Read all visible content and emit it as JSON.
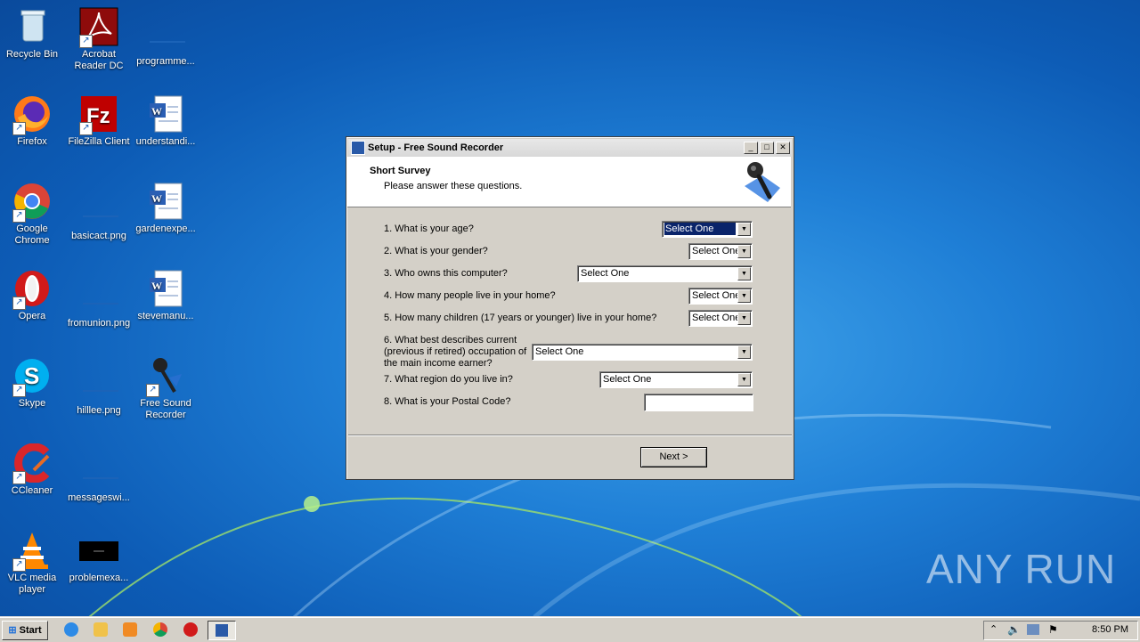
{
  "desktop": {
    "icons": [
      {
        "label": "Recycle Bin"
      },
      {
        "label": "Acrobat Reader DC"
      },
      {
        "label": "programme..."
      },
      {
        "label": "Firefox"
      },
      {
        "label": "FileZilla Client"
      },
      {
        "label": "understandi..."
      },
      {
        "label": "Google Chrome"
      },
      {
        "label": "basicact.png"
      },
      {
        "label": "gardenexpe..."
      },
      {
        "label": "Opera"
      },
      {
        "label": "fromunion.png"
      },
      {
        "label": "stevemanu..."
      },
      {
        "label": "Skype"
      },
      {
        "label": "hilllee.png"
      },
      {
        "label": "Free Sound Recorder"
      },
      {
        "label": "CCleaner"
      },
      {
        "label": "messageswi..."
      },
      {
        "label": "VLC media player"
      },
      {
        "label": "problemexa..."
      }
    ],
    "watermark": "ANY RUN"
  },
  "window": {
    "title": "Setup - Free Sound Recorder",
    "header_title": "Short Survey",
    "header_subtitle": "Please answer these questions.",
    "questions": [
      {
        "label": "1. What is your age?",
        "value": "Select One"
      },
      {
        "label": "2. What is your gender?",
        "value": "Select One"
      },
      {
        "label": "3. Who owns this computer?",
        "value": "Select One"
      },
      {
        "label": "4. How many people live in your home?",
        "value": "Select One"
      },
      {
        "label": "5. How many children (17 years or younger) live in your home?",
        "value": "Select One"
      },
      {
        "label": "6. What best describes current (previous if retired) occupation of the main income earner?",
        "value": "Select One"
      },
      {
        "label": "7. What region do you live in?",
        "value": "Select One"
      },
      {
        "label": "8. What is your Postal Code?",
        "value": ""
      }
    ],
    "next_label": "Next >"
  },
  "taskbar": {
    "start_label": "Start",
    "clock": "8:50 PM"
  }
}
